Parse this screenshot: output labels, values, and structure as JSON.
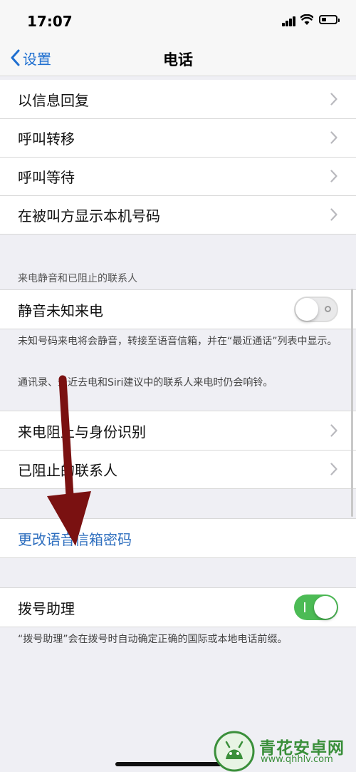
{
  "status_bar": {
    "time": "17:07"
  },
  "nav": {
    "back_label": "设置",
    "title": "电话"
  },
  "group1": {
    "items": [
      {
        "label": "以信息回复"
      },
      {
        "label": "呼叫转移"
      },
      {
        "label": "呼叫等待"
      },
      {
        "label": "在被叫方显示本机号码"
      }
    ]
  },
  "silence_section": {
    "header": "来电静音和已阻止的联系人",
    "toggle_label": "静音未知来电",
    "toggle_on": false,
    "footnote_1": "未知号码来电将会静音，转接至语音信箱，并在“最近通话”列表中显示。",
    "footnote_2": "通讯录、最近去电和Siri建议中的联系人来电时仍会响铃。"
  },
  "group2": {
    "items": [
      {
        "label": "来电阻止与身份识别"
      },
      {
        "label": "已阻止的联系人"
      }
    ]
  },
  "voicemail": {
    "link_label": "更改语音信箱密码"
  },
  "dial_assist": {
    "label": "拨号助理",
    "toggle_on": true,
    "footnote": "“拨号助理”会在拨号时自动确定正确的国际或本地电话前缀。"
  },
  "watermark": {
    "name": "青花安卓网",
    "url": "www.qhhlv.com"
  },
  "colors": {
    "link": "#2f6fbf",
    "toggle_on": "#4cbb55",
    "arrow": "#7a1111"
  }
}
